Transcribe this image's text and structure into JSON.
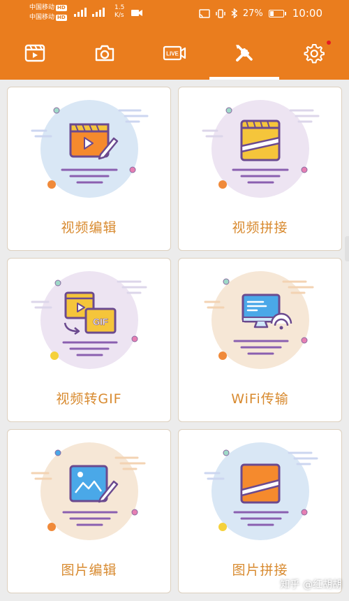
{
  "status_bar": {
    "carrier_1": "中国移动",
    "carrier_2": "中国移动",
    "hd_badge": "HD",
    "network_speed_value": "1.5",
    "network_speed_unit": "K/s",
    "battery_percent": "27%",
    "battery_level": 0.27,
    "time": "10:00"
  },
  "tabs": [
    {
      "icon": "video-clip-icon"
    },
    {
      "icon": "camera-icon"
    },
    {
      "icon": "live-icon",
      "text": "LIVE"
    },
    {
      "icon": "tools-icon",
      "active": true
    },
    {
      "icon": "settings-icon",
      "badge": true
    }
  ],
  "features": [
    {
      "label": "视频编辑",
      "bg": "#d9e7f5"
    },
    {
      "label": "视频拼接",
      "bg": "#ede4f2"
    },
    {
      "label": "视频转GIF",
      "bg": "#ede4f2",
      "badge": "GIF"
    },
    {
      "label": "WiFi传输",
      "bg": "#f6e7d6"
    },
    {
      "label": "图片编辑",
      "bg": "#f6e7d6"
    },
    {
      "label": "图片拼接",
      "bg": "#d9e7f5"
    }
  ],
  "colors": {
    "accent": "#ea7d1e",
    "label": "#d88a2f",
    "card_border": "#dccfbd"
  },
  "watermark": "知乎 @红胡胡"
}
